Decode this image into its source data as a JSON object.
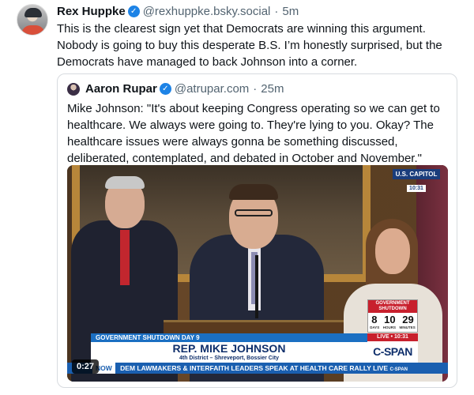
{
  "post": {
    "author_name": "Rex Huppke",
    "verified_mark": "✓",
    "handle": "@rexhuppke.bsky.social",
    "separator": "·",
    "time": "5m",
    "text": "This is the clearest sign yet that Democrats are winning this argument. Nobody is going to buy this desperate B.S. I’m honestly surprised, but the Democrats have managed to back Johnson into a corner."
  },
  "quote": {
    "author_name": "Aaron Rupar",
    "verified_mark": "✓",
    "handle": "@atrupar.com",
    "separator": "·",
    "time": "25m",
    "text": "Mike Johnson: \"It's about keeping Congress operating so we can get to healthcare. We always were going to. They're lying to you. Okay? The healthcare issues were always gonna be something discussed, deliberated, contemplated, and debated in October and November.\""
  },
  "video": {
    "duration": "0:27",
    "bug_line1": "U.S. CAPITOL",
    "bug_line2": "10:31",
    "shutdown_title": "GOVERNMENT SHUTDOWN",
    "shutdown_days": "8",
    "shutdown_hours": "10",
    "shutdown_minutes": "29",
    "shutdown_unit_days": "DAYS",
    "shutdown_unit_hours": "HOURS",
    "shutdown_unit_minutes": "MINUTES",
    "live_label": "LIVE • 10:31",
    "lower_third_top": "GOVERNMENT SHUTDOWN DAY 9",
    "lower_third_name": "REP. MIKE JOHNSON",
    "lower_third_sub": "4th District – Shreveport, Bossier City",
    "network": "C-SPAN",
    "ticker_now": "NOW",
    "ticker_text": "DEM LAWMAKERS & INTERFAITH LEADERS SPEAK AT HEALTH CARE RALLY LIVE",
    "ticker_network": "C-SPAN"
  },
  "colors": {
    "verified_badge": "#1d83e6",
    "cspan_blue": "#0f2f6b",
    "live_red": "#c8202d"
  }
}
